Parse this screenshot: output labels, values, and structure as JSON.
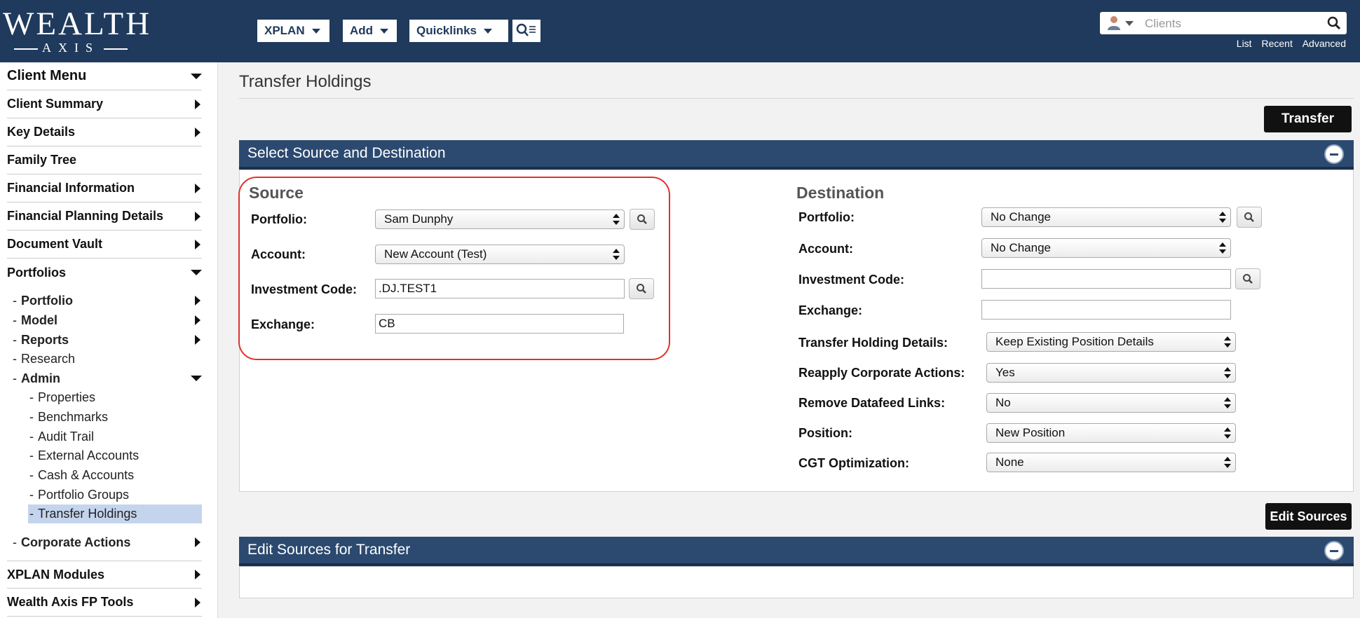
{
  "header": {
    "logo_main": "WEALTH",
    "logo_sub": "AXIS",
    "nav": [
      {
        "label": "XPLAN"
      },
      {
        "label": "Add"
      },
      {
        "label": "Quicklinks"
      }
    ],
    "search_placeholder": "Clients",
    "links": [
      "List",
      "Recent",
      "Advanced"
    ]
  },
  "sidebar": {
    "client_menu": "Client Menu",
    "items": [
      {
        "label": "Client Summary"
      },
      {
        "label": "Key Details"
      },
      {
        "label": "Family Tree"
      },
      {
        "label": "Financial Information"
      },
      {
        "label": "Financial Planning Details"
      },
      {
        "label": "Document Vault"
      },
      {
        "label": "Portfolios"
      }
    ],
    "portfolio_sub": [
      {
        "label": "Portfolio"
      },
      {
        "label": "Model"
      },
      {
        "label": "Reports"
      },
      {
        "label": "Research"
      },
      {
        "label": "Admin"
      }
    ],
    "admin_sub": [
      {
        "label": "Properties"
      },
      {
        "label": "Benchmarks"
      },
      {
        "label": "Audit Trail"
      },
      {
        "label": "External Accounts"
      },
      {
        "label": "Cash & Accounts"
      },
      {
        "label": "Portfolio Groups"
      },
      {
        "label": "Transfer Holdings"
      }
    ],
    "corporate_actions": "Corporate Actions",
    "bottom_items": [
      {
        "label": "XPLAN Modules"
      },
      {
        "label": "Wealth Axis FP Tools"
      }
    ]
  },
  "main": {
    "page_title": "Transfer Holdings",
    "transfer_button": "Transfer",
    "panel1_title": "Select Source and Destination",
    "source": {
      "title": "Source",
      "portfolio_label": "Portfolio:",
      "portfolio_value": "Sam Dunphy",
      "account_label": "Account:",
      "account_value": "New Account (Test)",
      "investment_code_label": "Investment Code:",
      "investment_code_value": ".DJ.TEST1",
      "exchange_label": "Exchange:",
      "exchange_value": "CB"
    },
    "destination": {
      "title": "Destination",
      "portfolio_label": "Portfolio:",
      "portfolio_value": "No Change",
      "account_label": "Account:",
      "account_value": "No Change",
      "investment_code_label": "Investment Code:",
      "investment_code_value": "",
      "exchange_label": "Exchange:",
      "exchange_value": "",
      "transfer_details_label": "Transfer Holding Details:",
      "transfer_details_value": "Keep Existing Position Details",
      "reapply_label": "Reapply Corporate Actions:",
      "reapply_value": "Yes",
      "remove_links_label": "Remove Datafeed Links:",
      "remove_links_value": "No",
      "position_label": "Position:",
      "position_value": "New Position",
      "cgt_label": "CGT Optimization:",
      "cgt_value": "None"
    },
    "edit_sources_button": "Edit Sources",
    "panel2_title": "Edit Sources for Transfer"
  },
  "colors": {
    "header_bg": "#1f3a5c",
    "panel_header": "#2c4a70",
    "highlight_outline": "#e0312a",
    "active_item": "#c4d4ec"
  }
}
